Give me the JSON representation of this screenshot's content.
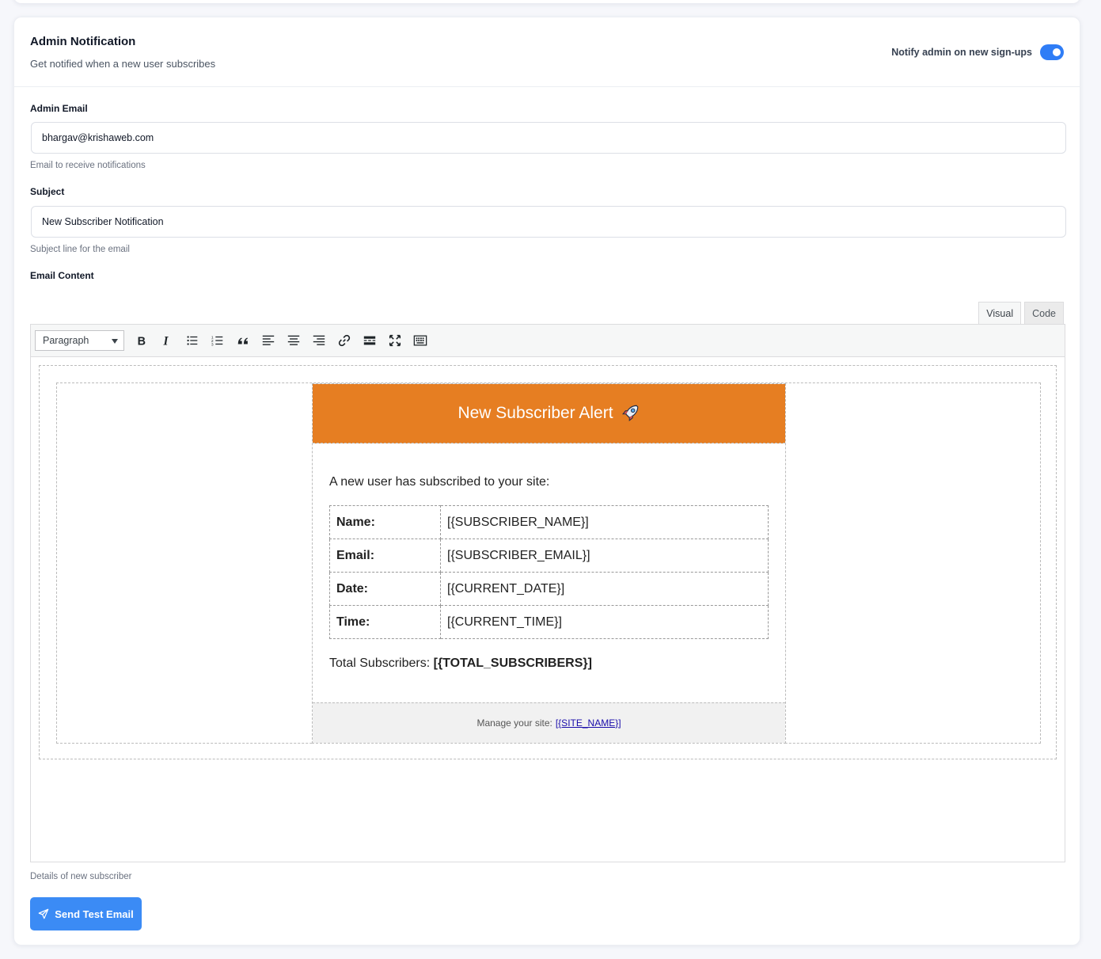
{
  "section": {
    "title": "Admin Notification",
    "description": "Get notified when a new user subscribes",
    "toggle_label": "Notify admin on new sign-ups",
    "toggle_on": true
  },
  "admin_email": {
    "label": "Admin Email",
    "value": "bhargav@krishaweb.com",
    "help": "Email to receive notifications"
  },
  "subject": {
    "label": "Subject",
    "value": "New Subscriber Notification",
    "help": "Subject line for the email"
  },
  "content": {
    "label": "Email Content",
    "tabs": [
      "Visual",
      "Code"
    ],
    "active_tab": "Visual",
    "help": "Details of new subscriber"
  },
  "toolbar": {
    "format": "Paragraph",
    "buttons": [
      "bold",
      "italic",
      "bullet-list",
      "numbered-list",
      "blockquote",
      "align-left",
      "align-center",
      "align-right",
      "link",
      "read-more",
      "fullscreen",
      "toolbar-toggle"
    ]
  },
  "email_preview": {
    "header_title": "New Subscriber Alert",
    "header_color": "#e67e22",
    "intro": "A new user has subscribed to your site:",
    "rows": [
      {
        "key": "Name:",
        "value": "[{SUBSCRIBER_NAME}]"
      },
      {
        "key": "Email:",
        "value": "[{SUBSCRIBER_EMAIL}]"
      },
      {
        "key": "Date:",
        "value": "[{CURRENT_DATE}]"
      },
      {
        "key": "Time:",
        "value": "[{CURRENT_TIME}]"
      }
    ],
    "total_label": "Total Subscribers:",
    "total_value": "[{TOTAL_SUBSCRIBERS}]",
    "footer_text": "Manage your site:",
    "footer_link": "[{SITE_NAME}]"
  },
  "actions": {
    "send_test_label": "Send Test Email",
    "accent": "#3b8bf5"
  }
}
